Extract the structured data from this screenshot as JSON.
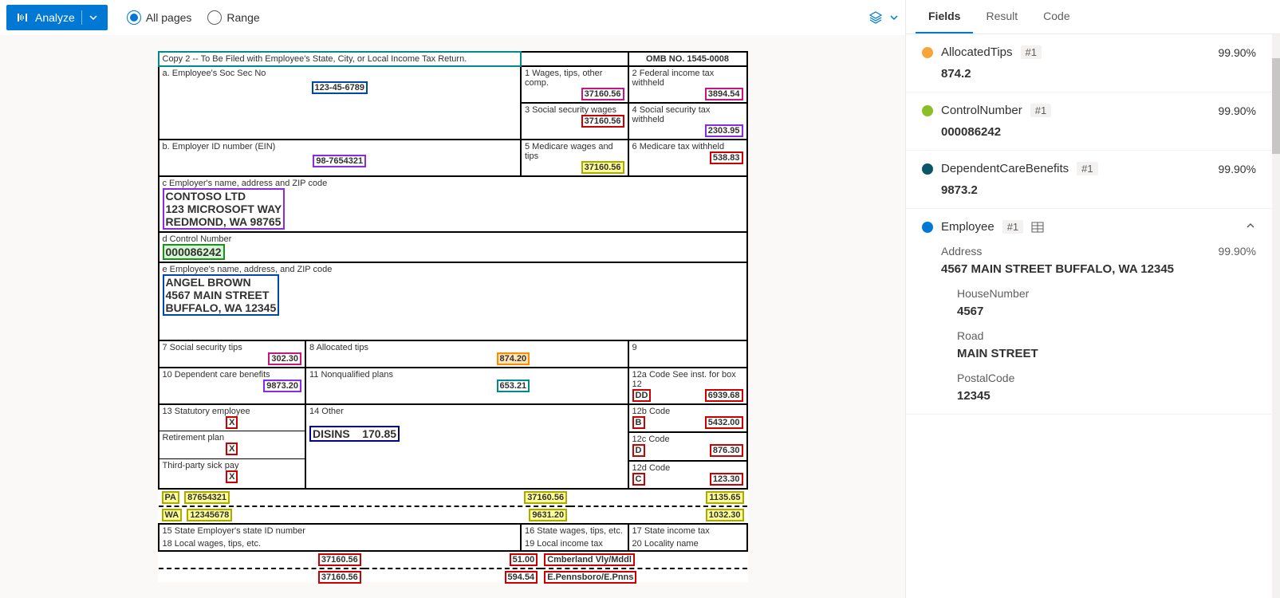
{
  "toolbar": {
    "analyze_label": "Analyze",
    "all_pages": "All pages",
    "range": "Range"
  },
  "tabs": {
    "fields": "Fields",
    "result": "Result",
    "code": "Code"
  },
  "form": {
    "copy_note": "Copy 2 -- To Be Filed with Employee's State, City, or Local Income Tax Return.",
    "omb": "OMB NO. 1545-0008",
    "a_label": "a. Employee's Soc Sec No",
    "a_val": "123-45-6789",
    "b_label": "b. Employer ID number (EIN)",
    "b_val": "98-7654321",
    "c_label": "c Employer's name, address and ZIP code",
    "c_val1": "CONTOSO LTD",
    "c_val2": "123 MICROSOFT WAY",
    "c_val3": "REDMOND, WA 98765",
    "d_label": "d Control Number",
    "d_val": "000086242",
    "e_label": "e Employee's name, address, and ZIP code",
    "e_val1": "ANGEL BROWN",
    "e_val2": "4567 MAIN STREET",
    "e_val3": "BUFFALO, WA 12345",
    "box1_label": "1 Wages, tips, other comp.",
    "box1_val": "37160.56",
    "box2_label": "2 Federal income tax withheld",
    "box2_val": "3894.54",
    "box3_label": "3 Social security wages",
    "box3_val": "37160.56",
    "box4_label": "4 Social security tax withheld",
    "box4_val": "2303.95",
    "box5_label": "5 Medicare wages and tips",
    "box5_val": "37160.56",
    "box6_label": "6 Medicare tax withheld",
    "box6_val": "538.83",
    "box7_label": "7 Social security tips",
    "box7_val": "302.30",
    "box8_label": "8 Allocated tips",
    "box8_val": "874.20",
    "box9_label": "9",
    "box10_label": "10 Dependent care benefits",
    "box10_val": "9873.20",
    "box11_label": "11 Nonqualified plans",
    "box11_val": "653.21",
    "box12a_label": "12a Code See inst. for box 12",
    "box12a_code": "DD",
    "box12a_val": "6939.68",
    "box12b_label": "12b Code",
    "box12b_code": "B",
    "box12b_val": "5432.00",
    "box12c_label": "12c Code",
    "box12c_code": "D",
    "box12c_val": "876.30",
    "box12d_label": "12d Code",
    "box12d_code": "C",
    "box12d_val": "123.30",
    "box13_label": "13 Statutory employee",
    "box13_x": "X",
    "box13_ret": "Retirement plan",
    "box13_retx": "X",
    "box13_sick": "Third-party sick pay",
    "box13_sickx": "X",
    "box14_label": "14 Other",
    "box14_val": "DISINS    170.85",
    "state1": "PA",
    "state1_id": "87654321",
    "state1_w": "37160.56",
    "state1_t": "1135.65",
    "state2": "WA",
    "state2_id": "12345678",
    "state2_w": "9631.20",
    "state2_t": "1032.30",
    "box15_label": "15 State Employer's state ID number",
    "box16_label": "16 State wages, tips, etc.",
    "box17_label": "17 State income tax",
    "box18_label": "18 Local wages, tips, etc.",
    "box19_label": "19 Local income tax",
    "box20_label": "20 Locality name",
    "local1_w": "37160.56",
    "local1_t": "51.00",
    "local1_n": "Cmberland Vly/Mddl",
    "local2_w": "37160.56",
    "local2_t": "594.54",
    "local2_n": "E.Pennsboro/E.Pnns"
  },
  "fields": [
    {
      "color": "#f7a439",
      "name": "AllocatedTips",
      "badge": "#1",
      "conf": "99.90%",
      "value": "874.2"
    },
    {
      "color": "#8cbf26",
      "name": "ControlNumber",
      "badge": "#1",
      "conf": "99.90%",
      "value": "000086242"
    },
    {
      "color": "#0b556a",
      "name": "DependentCareBenefits",
      "badge": "#1",
      "conf": "99.90%",
      "value": "9873.2"
    }
  ],
  "employee": {
    "color": "#0078d4",
    "name": "Employee",
    "badge": "#1",
    "address_label": "Address",
    "address_conf": "99.90%",
    "address_val": "4567 MAIN STREET BUFFALO, WA 12345",
    "house_label": "HouseNumber",
    "house_val": "4567",
    "road_label": "Road",
    "road_val": "MAIN STREET",
    "postal_label": "PostalCode",
    "postal_val": "12345"
  }
}
